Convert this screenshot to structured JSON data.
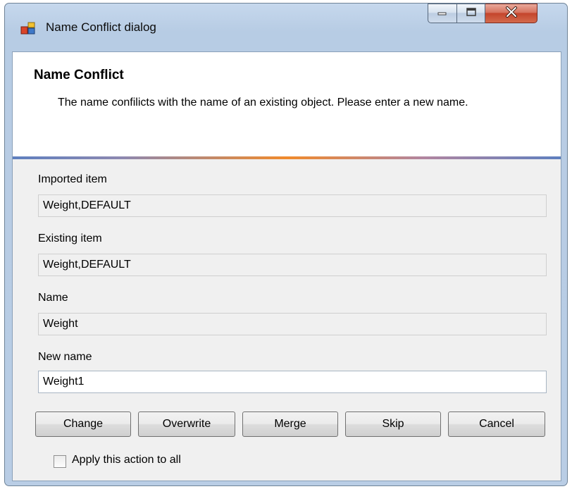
{
  "window": {
    "title": "Name Conflict dialog",
    "controls": {
      "minimize": "minimize-icon",
      "maximize": "maximize-icon",
      "close": "close-icon"
    }
  },
  "header": {
    "title": "Name Conflict",
    "description": "The name confilicts with the name of an existing object. Please enter a new name."
  },
  "fields": {
    "imported_label": "Imported item",
    "imported_value": "Weight,DEFAULT",
    "existing_label": "Existing item",
    "existing_value": "Weight,DEFAULT",
    "name_label": "Name",
    "name_value": "Weight",
    "new_name_label": "New name",
    "new_name_value": "Weight1"
  },
  "buttons": {
    "change": "Change",
    "overwrite": "Overwrite",
    "merge": "Merge",
    "skip": "Skip",
    "cancel": "Cancel"
  },
  "apply_all": {
    "label": "Apply this action to all",
    "checked": false
  },
  "colors": {
    "accent_stripe": [
      "#5e7fbf",
      "#f08a2c"
    ],
    "close_button": "#c4452c"
  }
}
